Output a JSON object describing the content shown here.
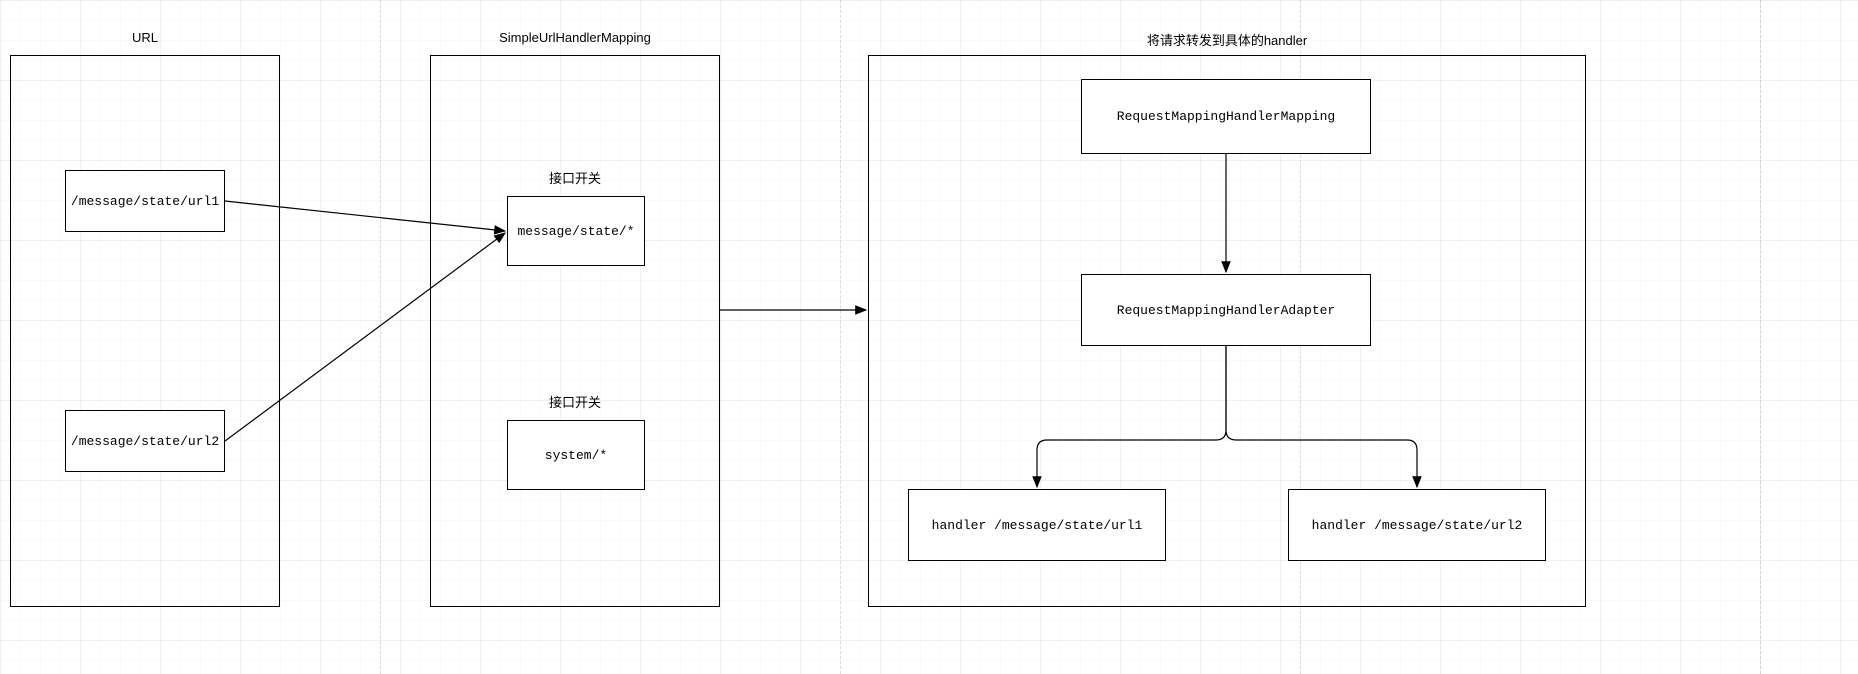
{
  "groups": {
    "url": {
      "title": "URL"
    },
    "mapping": {
      "title": "SimpleUrlHandlerMapping"
    },
    "handler": {
      "title": "将请求转发到具体的handler"
    }
  },
  "boxes": {
    "url1": "/message/state/url1",
    "url2": "/message/state/url2",
    "switch_label_1": "接口开关",
    "pattern1": "message/state/*",
    "switch_label_2": "接口开关",
    "pattern2": "system/*",
    "rmhm": "RequestMappingHandlerMapping",
    "rmha": "RequestMappingHandlerAdapter",
    "handler1": "handler /message/state/url1",
    "handler2": "handler /message/state/url2"
  }
}
